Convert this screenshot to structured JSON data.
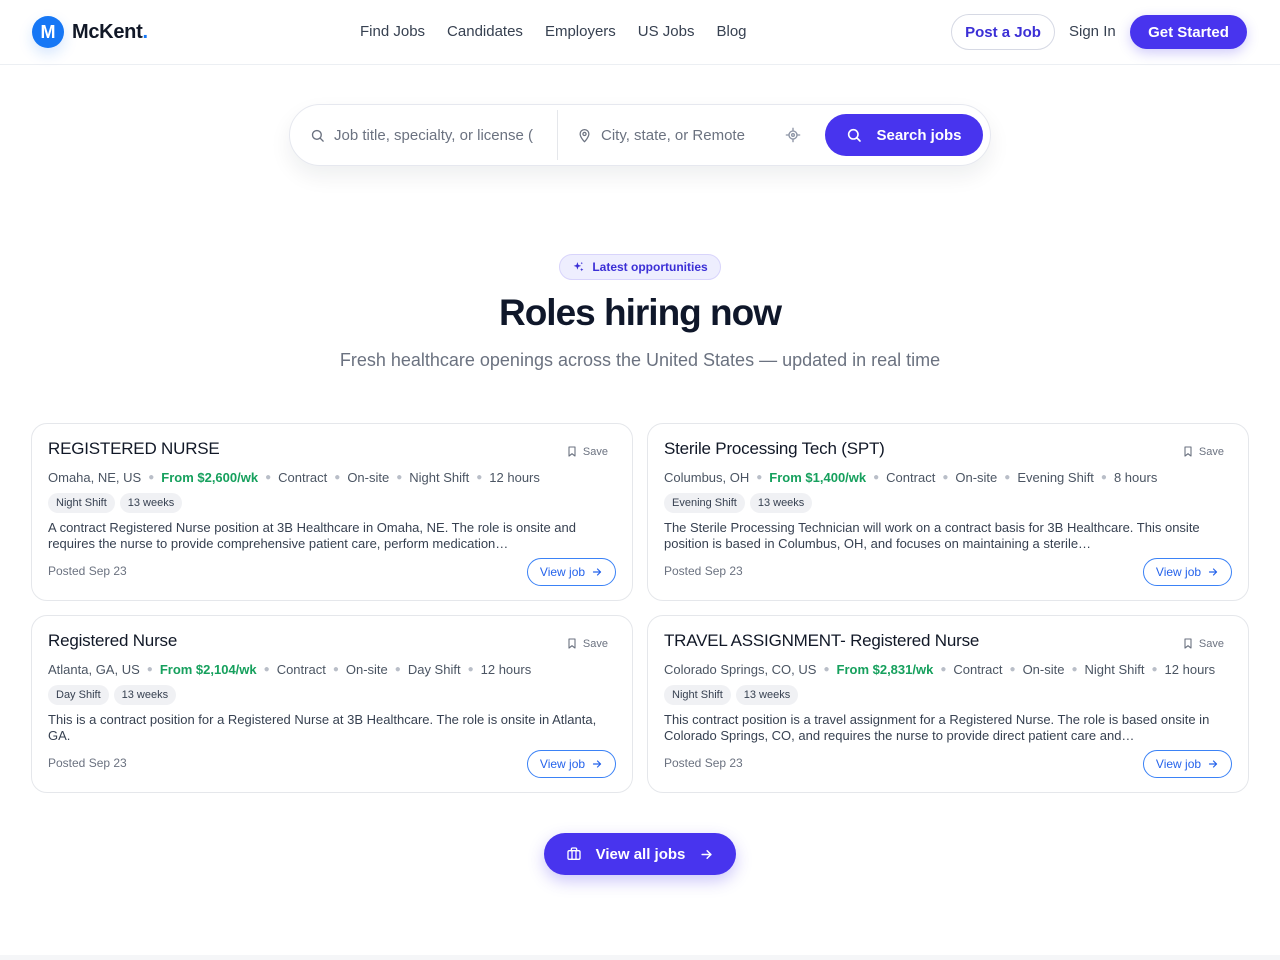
{
  "brand": {
    "initial": "M",
    "name": "McKent",
    "dot": ".",
    "color": "#1677f5"
  },
  "nav": [
    {
      "label": "Find Jobs"
    },
    {
      "label": "Candidates"
    },
    {
      "label": "Employers"
    },
    {
      "label": "US Jobs"
    },
    {
      "label": "Blog"
    }
  ],
  "header": {
    "post_label": "Post a Job",
    "signin_label": "Sign In",
    "cta_label": "Get Started"
  },
  "search": {
    "keyword_placeholder": "Job title, specialty, or license (",
    "location_placeholder": "City, state, or Remote",
    "button_label": "Search jobs",
    "icons": [
      "search-icon",
      "map-pin-icon",
      "crosshair-icon"
    ]
  },
  "section": {
    "eyebrow": "Latest opportunities",
    "title": "Roles hiring now",
    "subtitle": "Fresh healthcare openings across the United States — updated in real time"
  },
  "jobs": [
    {
      "title": "REGISTERED NURSE",
      "save": "Save",
      "location": "Omaha, NE, US",
      "pay": "From $2,600/wk",
      "type": "Contract",
      "setting": "On-site",
      "shift": "Night Shift",
      "hours": "12 hours",
      "tags": [
        "Night Shift",
        "13 weeks"
      ],
      "description": "A contract Registered Nurse position at 3B Healthcare in Omaha, NE. The role is onsite and requires the nurse to provide comprehensive patient care, perform medication…",
      "posted": "Posted Sep 23",
      "cta": "View job"
    },
    {
      "title": "Sterile Processing Tech (SPT)",
      "save": "Save",
      "location": "Columbus, OH",
      "pay": "From $1,400/wk",
      "type": "Contract",
      "setting": "On-site",
      "shift": "Evening Shift",
      "hours": "8 hours",
      "tags": [
        "Evening Shift",
        "13 weeks"
      ],
      "description": "The Sterile Processing Technician will work on a contract basis for 3B Healthcare. This onsite position is based in Columbus, OH, and focuses on maintaining a sterile…",
      "posted": "Posted Sep 23",
      "cta": "View job"
    },
    {
      "title": "Registered Nurse",
      "save": "Save",
      "location": "Atlanta, GA, US",
      "pay": "From $2,104/wk",
      "type": "Contract",
      "setting": "On-site",
      "shift": "Day Shift",
      "hours": "12 hours",
      "tags": [
        "Day Shift",
        "13 weeks"
      ],
      "description": "This is a contract position for a Registered Nurse at 3B Healthcare. The role is onsite in Atlanta, GA.",
      "posted": "Posted Sep 23",
      "cta": "View job"
    },
    {
      "title": "TRAVEL ASSIGNMENT- Registered Nurse",
      "save": "Save",
      "location": "Colorado Springs, CO, US",
      "pay": "From $2,831/wk",
      "type": "Contract",
      "setting": "On-site",
      "shift": "Night Shift",
      "hours": "12 hours",
      "tags": [
        "Night Shift",
        "13 weeks"
      ],
      "description": "This contract position is a travel assignment for a Registered Nurse. The role is based onsite in Colorado Springs, CO, and requires the nurse to provide direct patient care and…",
      "posted": "Posted Sep 23",
      "cta": "View job"
    }
  ],
  "view_all_label": "View all jobs",
  "colors": {
    "primary": "#4834ee",
    "pay": "#16a05d",
    "link": "#2563eb"
  }
}
